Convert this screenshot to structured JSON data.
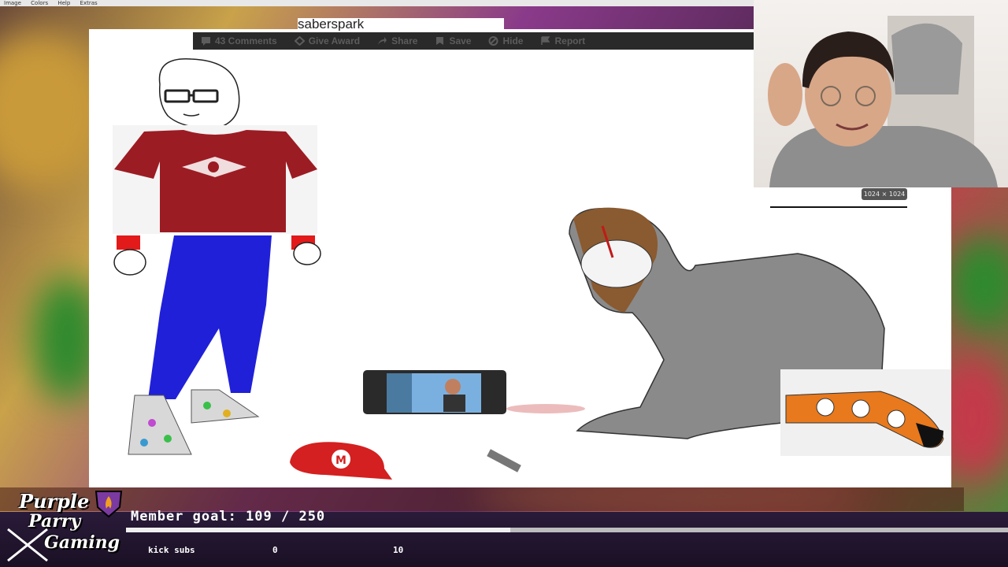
{
  "menubar": {
    "items": [
      "Image",
      "Colors",
      "Help",
      "Extras"
    ]
  },
  "post": {
    "username": "saberspark",
    "actions": [
      {
        "icon": "comment-icon",
        "label": "43 Comments"
      },
      {
        "icon": "award-icon",
        "label": "Give Award"
      },
      {
        "icon": "share-icon",
        "label": "Share"
      },
      {
        "icon": "save-icon",
        "label": "Save"
      },
      {
        "icon": "hide-icon",
        "label": "Hide"
      },
      {
        "icon": "report-icon",
        "label": "Report"
      }
    ]
  },
  "image_size_badge": "1024 × 1024",
  "overlay": {
    "logo": {
      "line1": "Purple",
      "line2": "Parry",
      "line3": "Gaming"
    },
    "member_goal_label": "Member goal: 109 / 250",
    "member_goal": {
      "current": 109,
      "target": 250
    },
    "kick_subs": {
      "label": "kick subs",
      "current": "0",
      "target": "10"
    }
  },
  "colors": {
    "shirt": "#9c1c24",
    "pants": "#2020d8",
    "cap": "#d42020",
    "sock": "#e8791c"
  }
}
